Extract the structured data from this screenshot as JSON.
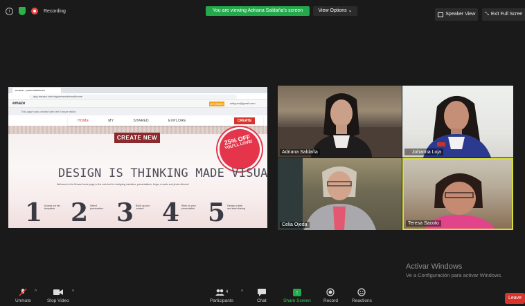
{
  "topbar": {
    "recording_label": "Recording",
    "viewing_banner": "You are viewing Adriana Saldaña's screen",
    "view_options": "View Options",
    "speaker_view": "Speaker View",
    "exit_full_screen": "Exit Full Scree"
  },
  "shared_screen": {
    "browser_tab": "emaze · presentaciones",
    "address": "app.emaze.com/mypresentations#home",
    "logo": "emaze",
    "upgrade": "UPGRADE",
    "account_email": "aeliguru@gmail.com",
    "notice": "This page was created with the Emaze editor",
    "nav": {
      "home": "HOME",
      "my": "MY",
      "shared": "SHARED",
      "explore": "EXPLORE"
    },
    "create_button": "CREATE",
    "create_new": "CREATE NEW",
    "badge_main": "25% OFF",
    "badge_sub": "YOU'LL LOVE!",
    "hero_title": "DESIGN IS THINKING MADE VISUAL",
    "hero_desc": "Welcome to the Emaze home page to the web tool for designing websites, presentations, blogs, e-cards and photo albums!",
    "steps": [
      {
        "num": "1",
        "text": "Access our fav templates"
      },
      {
        "num": "2",
        "text": "Select presentation"
      },
      {
        "num": "3",
        "text": "Build up your content"
      },
      {
        "num": "4",
        "text": "Work on your presentation"
      },
      {
        "num": "5",
        "text": "Design a style and start sharing"
      }
    ]
  },
  "participants": [
    {
      "name": "Adriana Saldaña"
    },
    {
      "name": "Johanna Loja"
    },
    {
      "name": "Celia Ojeda"
    },
    {
      "name": "Teresa Sacoto"
    }
  ],
  "activate_windows": {
    "title": "Activar Windows",
    "subtitle": "Ve a Configuración para activar Windows."
  },
  "toolbar": {
    "unmute": "Unmute",
    "stop_video": "Stop Video",
    "participants": "Participants",
    "participants_count": "4",
    "chat": "Chat",
    "share_screen": "Share Screen",
    "record": "Record",
    "reactions": "Reactions",
    "leave": "Leave"
  }
}
